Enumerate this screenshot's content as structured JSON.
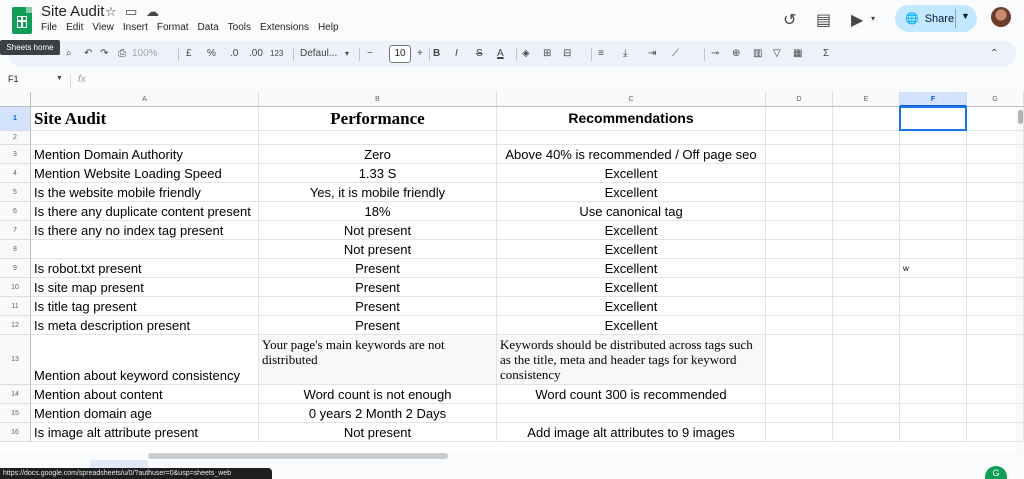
{
  "app": {
    "doc_title": "Site Audit",
    "menu": [
      "File",
      "Edit",
      "View",
      "Insert",
      "Format",
      "Data",
      "Tools",
      "Extensions",
      "Help"
    ],
    "share_label": "Share",
    "tooltip": "Sheets home"
  },
  "toolbar": {
    "zoom": "100%",
    "currency": "£",
    "percent": "%",
    "decrease_decimal": ".0",
    "increase_decimal": ".00",
    "number_format": "123",
    "font": "Defaul...",
    "font_size": "10",
    "bold": "B",
    "italic": "I",
    "strikethrough": "S",
    "text_color": "A"
  },
  "formula_bar": {
    "name_box": "F1",
    "fx": "fx"
  },
  "columns": [
    "A",
    "B",
    "C",
    "D",
    "E",
    "F",
    "G"
  ],
  "rows": [
    {
      "num": "1",
      "a": "Site Audit",
      "b": "Performance",
      "c": "Recommendations"
    },
    {
      "num": "2",
      "a": "",
      "b": "",
      "c": ""
    },
    {
      "num": "3",
      "a": "Mention Domain Authority",
      "b": "Zero",
      "c": "Above 40% is recommended / Off page seo"
    },
    {
      "num": "4",
      "a": "Mention Website Loading Speed",
      "b": "1.33 S",
      "c": "Excellent"
    },
    {
      "num": "5",
      "a": "Is the website mobile friendly",
      "b": "Yes, it is mobile friendly",
      "c": "Excellent"
    },
    {
      "num": "6",
      "a": "Is there any duplicate content present",
      "b": "18%",
      "c": "Use canonical tag"
    },
    {
      "num": "7",
      "a": "Is there any no index tag present",
      "b": "Not present",
      "c": "Excellent"
    },
    {
      "num": "8",
      "a": "",
      "b": "Not present",
      "c": "Excellent"
    },
    {
      "num": "9",
      "a": "Is robot.txt present",
      "b": "Present",
      "c": "Excellent",
      "f": "w"
    },
    {
      "num": "10",
      "a": "Is site map present",
      "b": "Present",
      "c": "Excellent"
    },
    {
      "num": "11",
      "a": "Is title tag present",
      "b": "Present",
      "c": "Excellent"
    },
    {
      "num": "12",
      "a": "Is meta description present",
      "b": "Present",
      "c": "Excellent"
    },
    {
      "num": "13",
      "a": "Mention about keyword consistency",
      "b": "Your page's main keywords are not distributed",
      "c": "Keywords should be distributed across tags such as the title, meta and header tags for keyword consistency"
    },
    {
      "num": "14",
      "a": "Mention about content",
      "b": "Word count is not enough",
      "c": "Word count 300 is recommended"
    },
    {
      "num": "15",
      "a": "Mention domain age",
      "b": "0 years 2 Month 2 Days",
      "c": ""
    },
    {
      "num": "16",
      "a": "Is image alt attribute present",
      "b": "Not present",
      "c": "Add image alt attributes to 9 images"
    }
  ],
  "status_url": "https://docs.google.com/spreadsheets/u/0/?authuser=0&usp=sheets_web"
}
